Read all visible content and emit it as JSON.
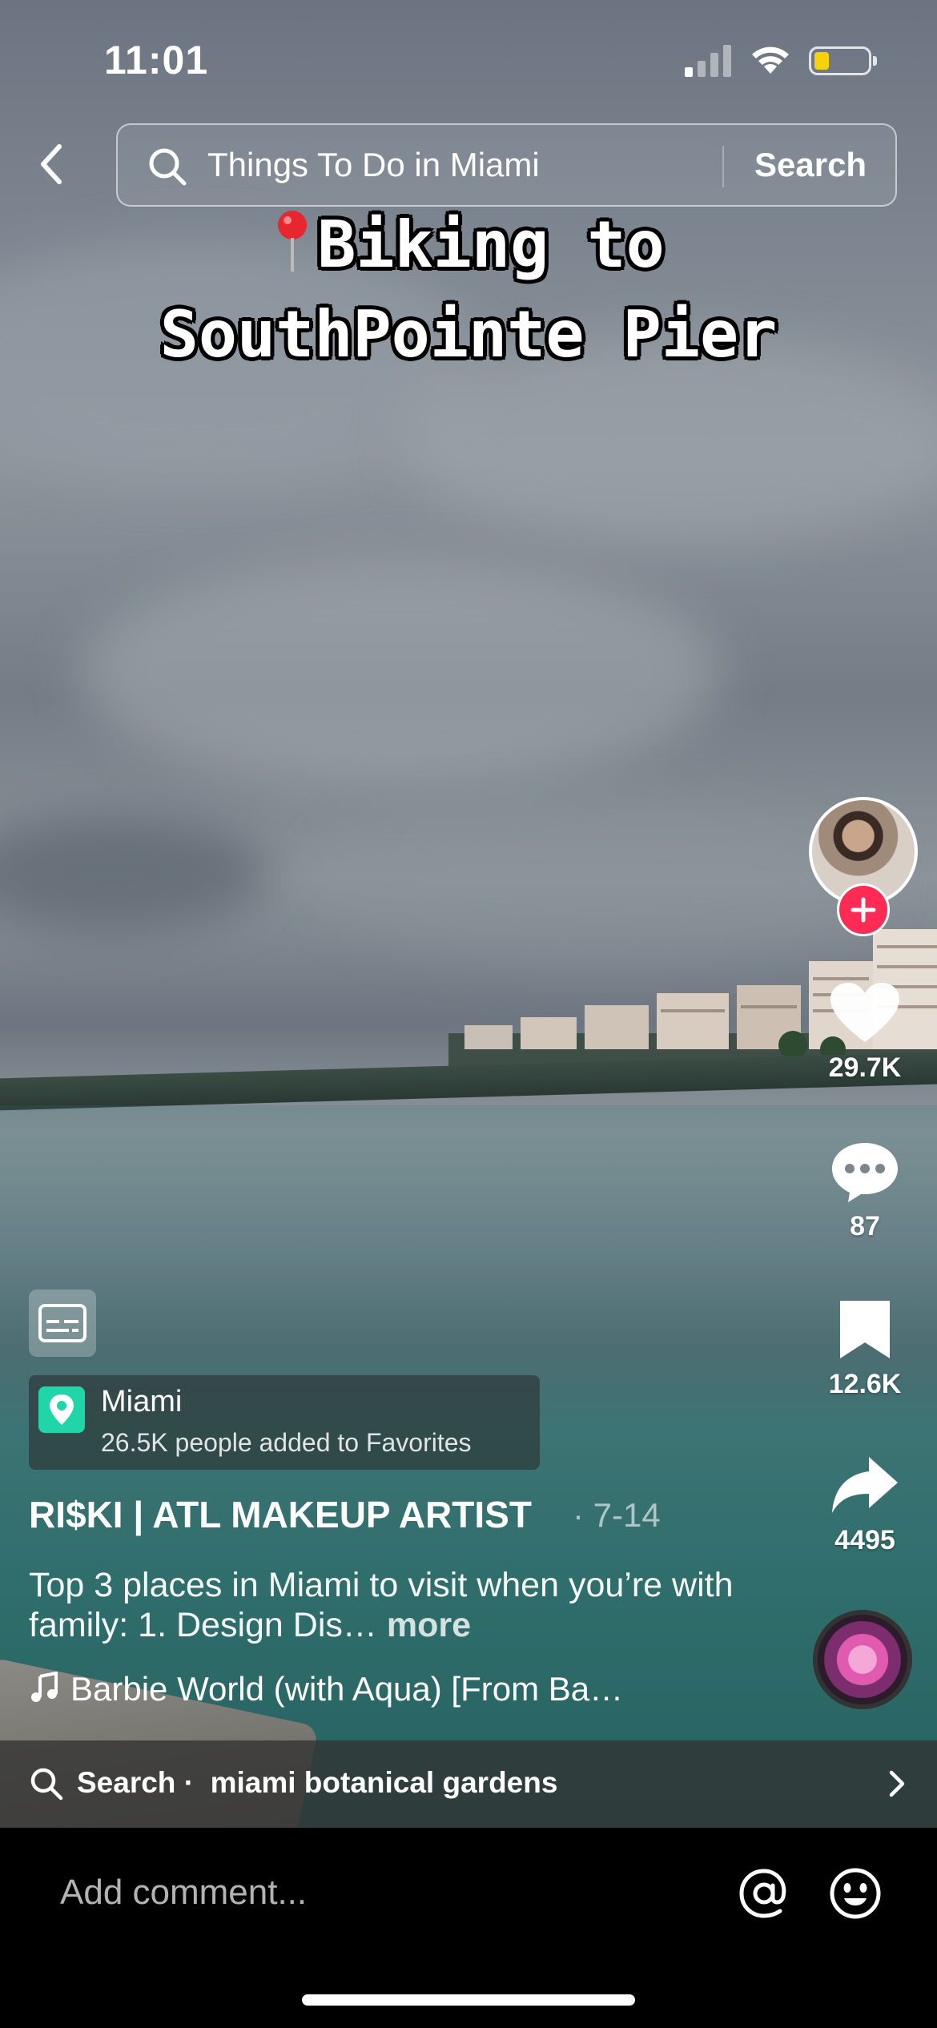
{
  "status": {
    "time": "11:01"
  },
  "search": {
    "query": "Things To Do in Miami",
    "button_label": "Search"
  },
  "overlay": {
    "line1": "Biking to",
    "line2": "SouthPointe Pier"
  },
  "actions": {
    "likes": "29.7K",
    "comments": "87",
    "saves": "12.6K",
    "shares": "4495"
  },
  "location": {
    "name": "Miami",
    "subtitle": "26.5K people added to Favorites"
  },
  "author": {
    "name": "RI$KI | ATL MAKEUP ARTIST",
    "date": "· 7-14"
  },
  "description": {
    "text": "Top 3 places in Miami to visit when you’re with family:  1. Design Dis…",
    "more": "more"
  },
  "music": {
    "title": "Barbie World (with Aqua) [From Ba…"
  },
  "suggestion": {
    "prefix": "Search ·",
    "term": "miami botanical gardens"
  },
  "comment": {
    "placeholder": "Add comment..."
  },
  "colors": {
    "follow": "#fe2c55",
    "location_pin": "#20d5a7",
    "battery": "#f5d20a"
  }
}
